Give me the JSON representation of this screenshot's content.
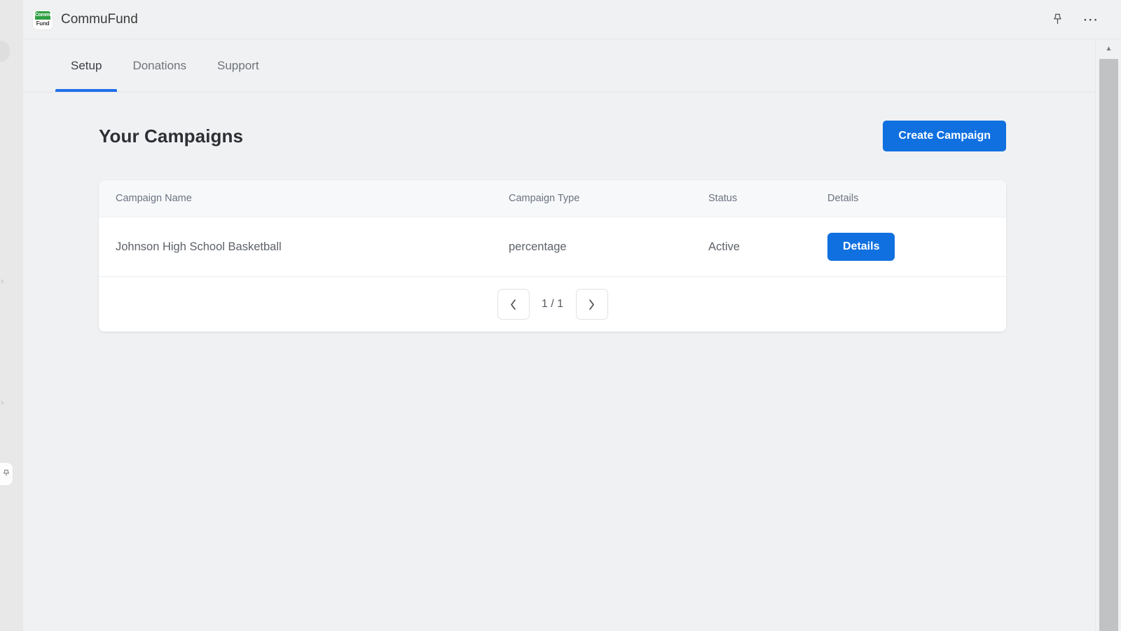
{
  "app": {
    "title": "CommuFund",
    "logo": {
      "top_text": "Commu",
      "bottom_text": "Fund",
      "color": "#2f9e41"
    },
    "titlebar_actions": [
      {
        "name": "pin-icon",
        "label": "Pin"
      },
      {
        "name": "more-options-icon",
        "label": "…"
      }
    ]
  },
  "tabs": [
    {
      "label": "Setup",
      "active": true
    },
    {
      "label": "Donations",
      "active": false
    },
    {
      "label": "Support",
      "active": false
    }
  ],
  "page": {
    "title": "Your Campaigns",
    "create_button": "Create Campaign"
  },
  "table": {
    "columns": [
      "Campaign Name",
      "Campaign Type",
      "Status",
      "Details"
    ],
    "rows": [
      {
        "name": "Johnson High School Basketball",
        "type": "percentage",
        "status": "Active",
        "details_label": "Details"
      }
    ]
  },
  "pagination": {
    "prev_icon": "‹",
    "next_icon": "›",
    "label": "1 / 1"
  },
  "colors": {
    "accent": "#1070e0",
    "tab_underline": "#1f6feb",
    "page_background": "#eff1f3",
    "card_background": "#ffffff"
  }
}
